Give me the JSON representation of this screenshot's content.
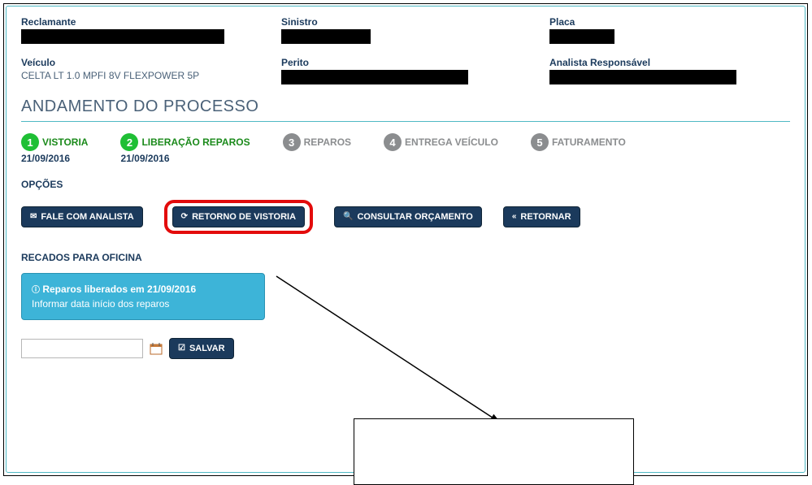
{
  "header": {
    "reclamante_label": "Reclamante",
    "sinistro_label": "Sinistro",
    "placa_label": "Placa",
    "veiculo_label": "Veículo",
    "veiculo_value": "CELTA LT 1.0 MPFI 8V FLEXPOWER 5P",
    "perito_label": "Perito",
    "analista_label": "Analista Responsável"
  },
  "section_title": "ANDAMENTO DO PROCESSO",
  "steps": [
    {
      "num": "1",
      "label": "VISTORIA",
      "date": "21/09/2016",
      "status": "done"
    },
    {
      "num": "2",
      "label": "LIBERAÇÃO REPAROS",
      "date": "21/09/2016",
      "status": "done"
    },
    {
      "num": "3",
      "label": "REPAROS",
      "date": "",
      "status": "pending"
    },
    {
      "num": "4",
      "label": "ENTREGA VEÍCULO",
      "date": "",
      "status": "pending"
    },
    {
      "num": "5",
      "label": "FATURAMENTO",
      "date": "",
      "status": "pending"
    }
  ],
  "opcoes_label": "OPÇÕES",
  "buttons": {
    "fale": "FALE COM ANALISTA",
    "retorno": "RETORNO DE VISTORIA",
    "consultar": "CONSULTAR ORÇAMENTO",
    "retornar": "RETORNAR"
  },
  "recados_label": "RECADOS PARA OFICINA",
  "callout": {
    "line1": "Reparos liberados em 21/09/2016",
    "line2": "Informar data início dos reparos"
  },
  "save_label": "SALVAR",
  "date_value": ""
}
